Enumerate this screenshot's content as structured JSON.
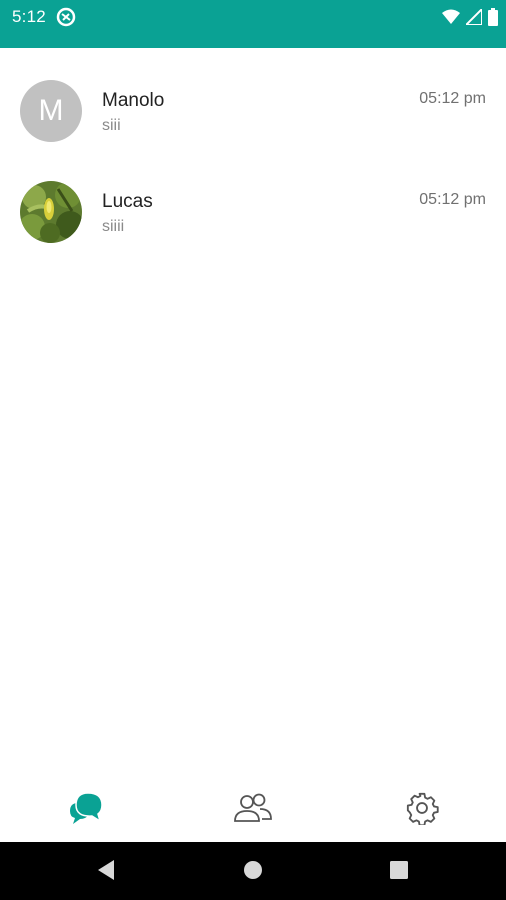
{
  "status_bar": {
    "time": "5:12",
    "background": "#0aa294"
  },
  "chats": [
    {
      "name": "Manolo",
      "preview": "siii",
      "time": "05:12 pm",
      "avatar_letter": "M",
      "avatar_type": "letter"
    },
    {
      "name": "Lucas",
      "preview": "siiii",
      "time": "05:12 pm",
      "avatar_type": "photo"
    }
  ],
  "bottom_nav": {
    "items": [
      {
        "icon": "chats-icon",
        "active": true
      },
      {
        "icon": "contacts-icon",
        "active": false
      },
      {
        "icon": "settings-icon",
        "active": false
      }
    ],
    "active_color": "#0aa294",
    "inactive_color": "#555555"
  },
  "system_nav": {
    "items": [
      "back-icon",
      "home-icon",
      "recents-icon"
    ]
  }
}
